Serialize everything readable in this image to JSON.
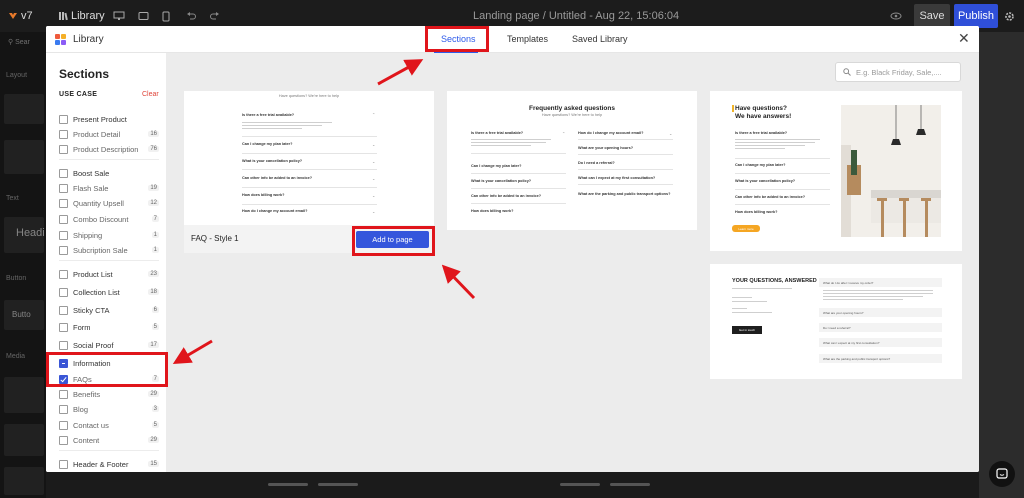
{
  "topbar": {
    "version": "v7",
    "library_label": "Library",
    "page_title": "Landing page / Untitled - Aug 22, 15:06:04",
    "save_label": "Save",
    "publish_label": "Publish"
  },
  "background_sidebar": {
    "search_label": "Sear",
    "sections": [
      "Layout",
      "Text",
      "Button",
      "Media"
    ],
    "heading_text": "Headi",
    "button_text": "Butto"
  },
  "modal": {
    "title": "Library",
    "tabs": [
      {
        "label": "Sections",
        "active": true
      },
      {
        "label": "Templates",
        "active": false
      },
      {
        "label": "Saved Library",
        "active": false
      }
    ],
    "close_icon": "close-icon"
  },
  "sidebar": {
    "title": "Sections",
    "use_case_label": "USE CASE",
    "clear_label": "Clear",
    "items": [
      {
        "label": "Present Product",
        "count": "",
        "level": "group"
      },
      {
        "label": "Product Detail",
        "count": "16",
        "level": "sub"
      },
      {
        "label": "Product Description",
        "count": "76",
        "level": "sub"
      },
      {
        "label": "Boost Sale",
        "count": "",
        "level": "group"
      },
      {
        "label": "Flash Sale",
        "count": "19",
        "level": "sub"
      },
      {
        "label": "Quantity Upsell",
        "count": "12",
        "level": "sub"
      },
      {
        "label": "Combo Discount",
        "count": "7",
        "level": "sub"
      },
      {
        "label": "Shipping",
        "count": "1",
        "level": "sub"
      },
      {
        "label": "Subcription Sale",
        "count": "1",
        "level": "sub"
      },
      {
        "label": "Product List",
        "count": "23",
        "level": "group"
      },
      {
        "label": "Collection List",
        "count": "18",
        "level": "group"
      },
      {
        "label": "Sticky CTA",
        "count": "6",
        "level": "group"
      },
      {
        "label": "Form",
        "count": "5",
        "level": "group"
      },
      {
        "label": "Social Proof",
        "count": "17",
        "level": "group"
      },
      {
        "label": "Information",
        "count": "",
        "level": "group",
        "state": "indeterminate"
      },
      {
        "label": "FAQs",
        "count": "7",
        "level": "sub",
        "state": "checked"
      },
      {
        "label": "Benefits",
        "count": "29",
        "level": "sub"
      },
      {
        "label": "Blog",
        "count": "3",
        "level": "sub"
      },
      {
        "label": "Contact us",
        "count": "5",
        "level": "sub"
      },
      {
        "label": "Content",
        "count": "29",
        "level": "sub"
      },
      {
        "label": "Header & Footer",
        "count": "15",
        "level": "group"
      }
    ]
  },
  "search": {
    "placeholder": "E.g. Black Friday, Sale,...."
  },
  "cards": {
    "card1": {
      "name": "FAQ - Style 1",
      "add_label": "Add to page",
      "subtitle": "Have questions? We're here to help",
      "questions": [
        "Is there a free trial available?",
        "Can I change my plan later?",
        "What is your cancellation policy?",
        "Can other info be added to an invoice?",
        "How does billing work?",
        "How do I change my account email?"
      ]
    },
    "card2": {
      "title": "Frequently asked questions",
      "subtitle": "Have questions? We're here to help",
      "left_questions": [
        "Is there a free trial available?",
        "Can I change my plan later?",
        "What is your cancellation policy?",
        "Can other info be added to an invoice?",
        "How does billing work?"
      ],
      "right_questions": [
        "How do I change my account email?",
        "What are your opening hours?",
        "Do I need a referral?",
        "What can I expect at my first consultation?",
        "What are the parking and public transport options?"
      ]
    },
    "card3": {
      "title_line1": "Have questions?",
      "title_line2": "We have answers!",
      "questions": [
        "Is there a free trial available?",
        "Can I change my plan later?",
        "What is your cancellation policy?",
        "Can other info be added to an invoice?",
        "How does billing work?"
      ],
      "button_label": "Learn more"
    },
    "card4": {
      "title": "YOUR QUESTIONS, ANSWERED",
      "button_label": "Get in touch",
      "questions": [
        "What do I do after I receive my order?",
        "What are your opening hours?",
        "Do I need a referral?",
        "What can I expect at my first consultation?",
        "What are the parking and public transport options?"
      ]
    }
  },
  "colors": {
    "accent": "#2f5bea",
    "highlight_red": "#e0151b",
    "publish_blue": "#2f4fd8"
  }
}
